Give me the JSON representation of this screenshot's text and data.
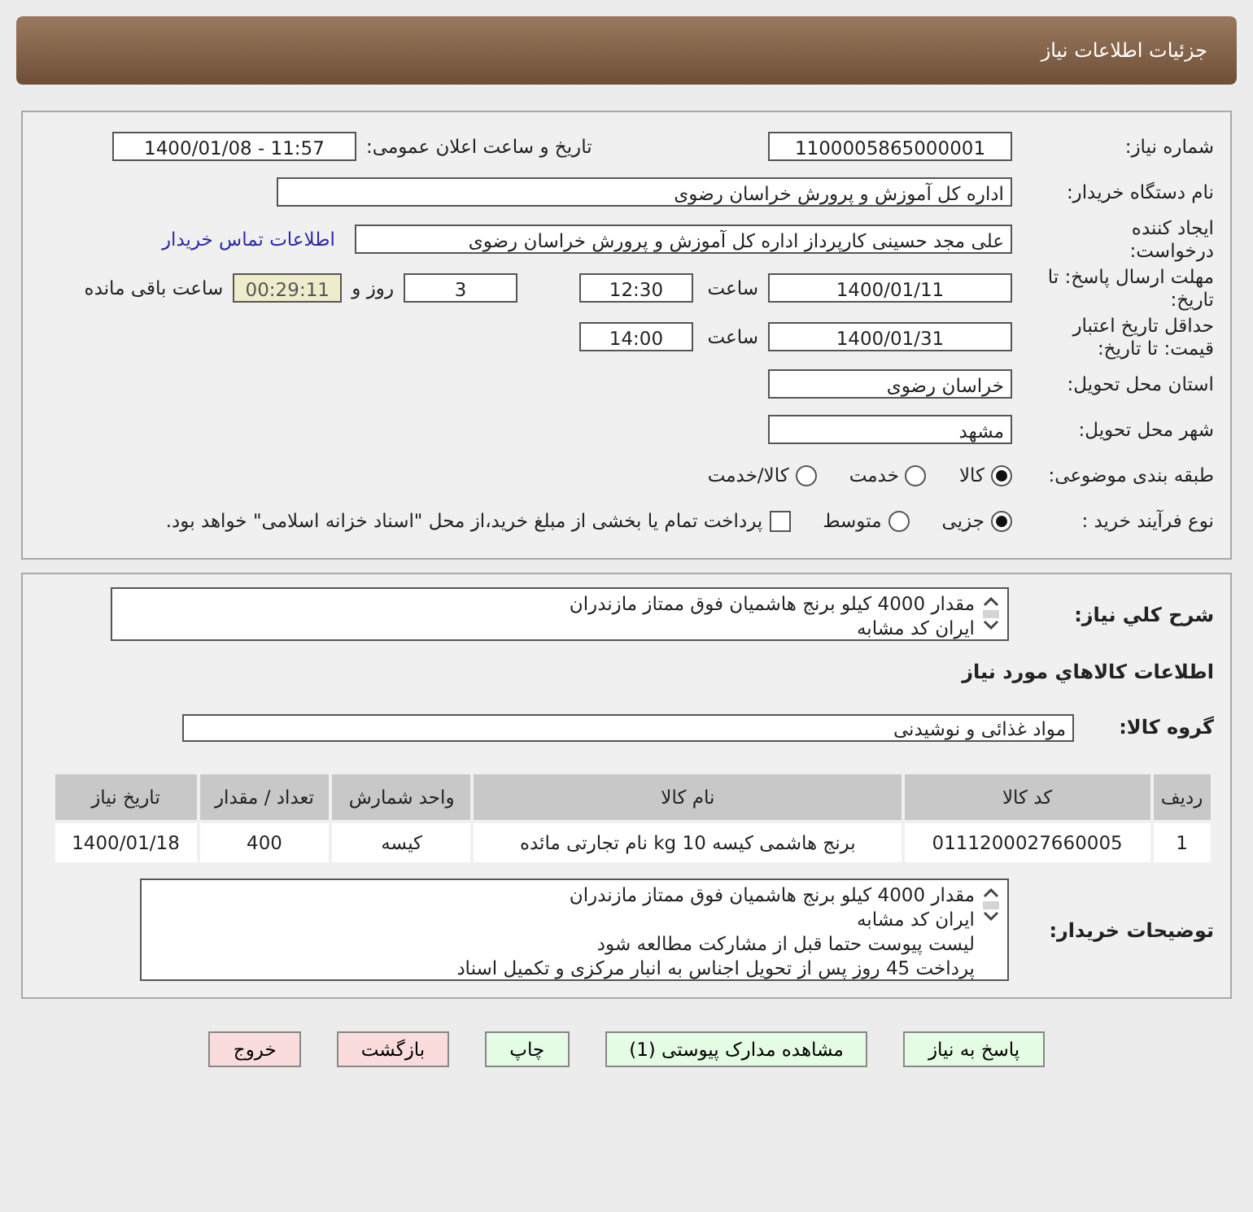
{
  "header": {
    "title": "جزئیات اطلاعات نیاز"
  },
  "need_number": {
    "label": "شماره نیاز:",
    "value": "1100005865000001"
  },
  "announce": {
    "label": "تاریخ و ساعت اعلان عمومی:",
    "value": "1400/01/08 - 11:57"
  },
  "buyer_org": {
    "label": "نام دستگاه خریدار:",
    "value": "اداره کل آموزش و پرورش خراسان رضوی"
  },
  "requester": {
    "label": "ایجاد کننده درخواست:",
    "value": "علی مجد حسینی کارپرداز اداره کل آموزش و پرورش خراسان رضوی",
    "link": "اطلاعات تماس خریدار"
  },
  "reply_deadline": {
    "label": "مهلت ارسال پاسخ: تا تاریخ:",
    "date": "1400/01/11",
    "time_label": "ساعت",
    "time": "12:30",
    "days": "3",
    "days_label": "روز و",
    "remaining": "00:29:11",
    "remaining_label": "ساعت باقی مانده"
  },
  "price_validity": {
    "label": "حداقل تاریخ اعتبار قیمت: تا تاریخ:",
    "date": "1400/01/31",
    "time_label": "ساعت",
    "time": "14:00"
  },
  "province": {
    "label": "استان محل تحویل:",
    "value": "خراسان رضوی"
  },
  "city": {
    "label": "شهر محل تحویل:",
    "value": "مشهد"
  },
  "category": {
    "label": "طبقه بندی موضوعی:",
    "options": [
      {
        "label": "کالا",
        "selected": true
      },
      {
        "label": "خدمت",
        "selected": false
      },
      {
        "label": "کالا/خدمت",
        "selected": false
      }
    ]
  },
  "purchase_type": {
    "label": "نوع فرآیند خرید :",
    "options": [
      {
        "label": "جزیی",
        "selected": true
      },
      {
        "label": "متوسط",
        "selected": false
      }
    ],
    "treasury": {
      "label": "پرداخت تمام یا بخشی از مبلغ خرید،از محل \"اسناد خزانه اسلامی\" خواهد بود.",
      "checked": false
    }
  },
  "description": {
    "label": "شرح کلي نياز:",
    "lines": [
      "مقدار 4000 کیلو برنج هاشمیان فوق ممتاز مازندران",
      "ایران کد مشابه"
    ]
  },
  "goods_heading": "اطلاعات کالاهاي مورد نياز",
  "group": {
    "label": "گروه کالا:",
    "value": "مواد غذائی و نوشیدنی"
  },
  "table": {
    "columns": [
      "ردیف",
      "کد کالا",
      "نام کالا",
      "واحد شمارش",
      "تعداد / مقدار",
      "تاریخ نیاز"
    ],
    "rows": [
      [
        "1",
        "0111200027660005",
        "برنج هاشمی کیسه 10 kg نام تجارتی مائده",
        "کیسه",
        "400",
        "1400/01/18"
      ]
    ]
  },
  "buyer_notes": {
    "label": "توضیحات خریدار:",
    "lines": [
      "مقدار 4000 کیلو برنج هاشمیان فوق ممتاز مازندران",
      "ایران کد مشابه",
      "لیست پیوست حتما قبل از مشارکت مطالعه شود",
      "پرداخت 45 روز پس از تحویل اجناس به انبار مرکزی و تکمیل اسناد"
    ]
  },
  "buttons": [
    {
      "label": "پاسخ به نیاز",
      "kind": "action"
    },
    {
      "label": "مشاهده مدارک پیوستی (1)",
      "kind": "action"
    },
    {
      "label": "چاپ",
      "kind": "action"
    },
    {
      "label": "بازگشت",
      "kind": "exit"
    },
    {
      "label": "خروج",
      "kind": "exit"
    }
  ]
}
